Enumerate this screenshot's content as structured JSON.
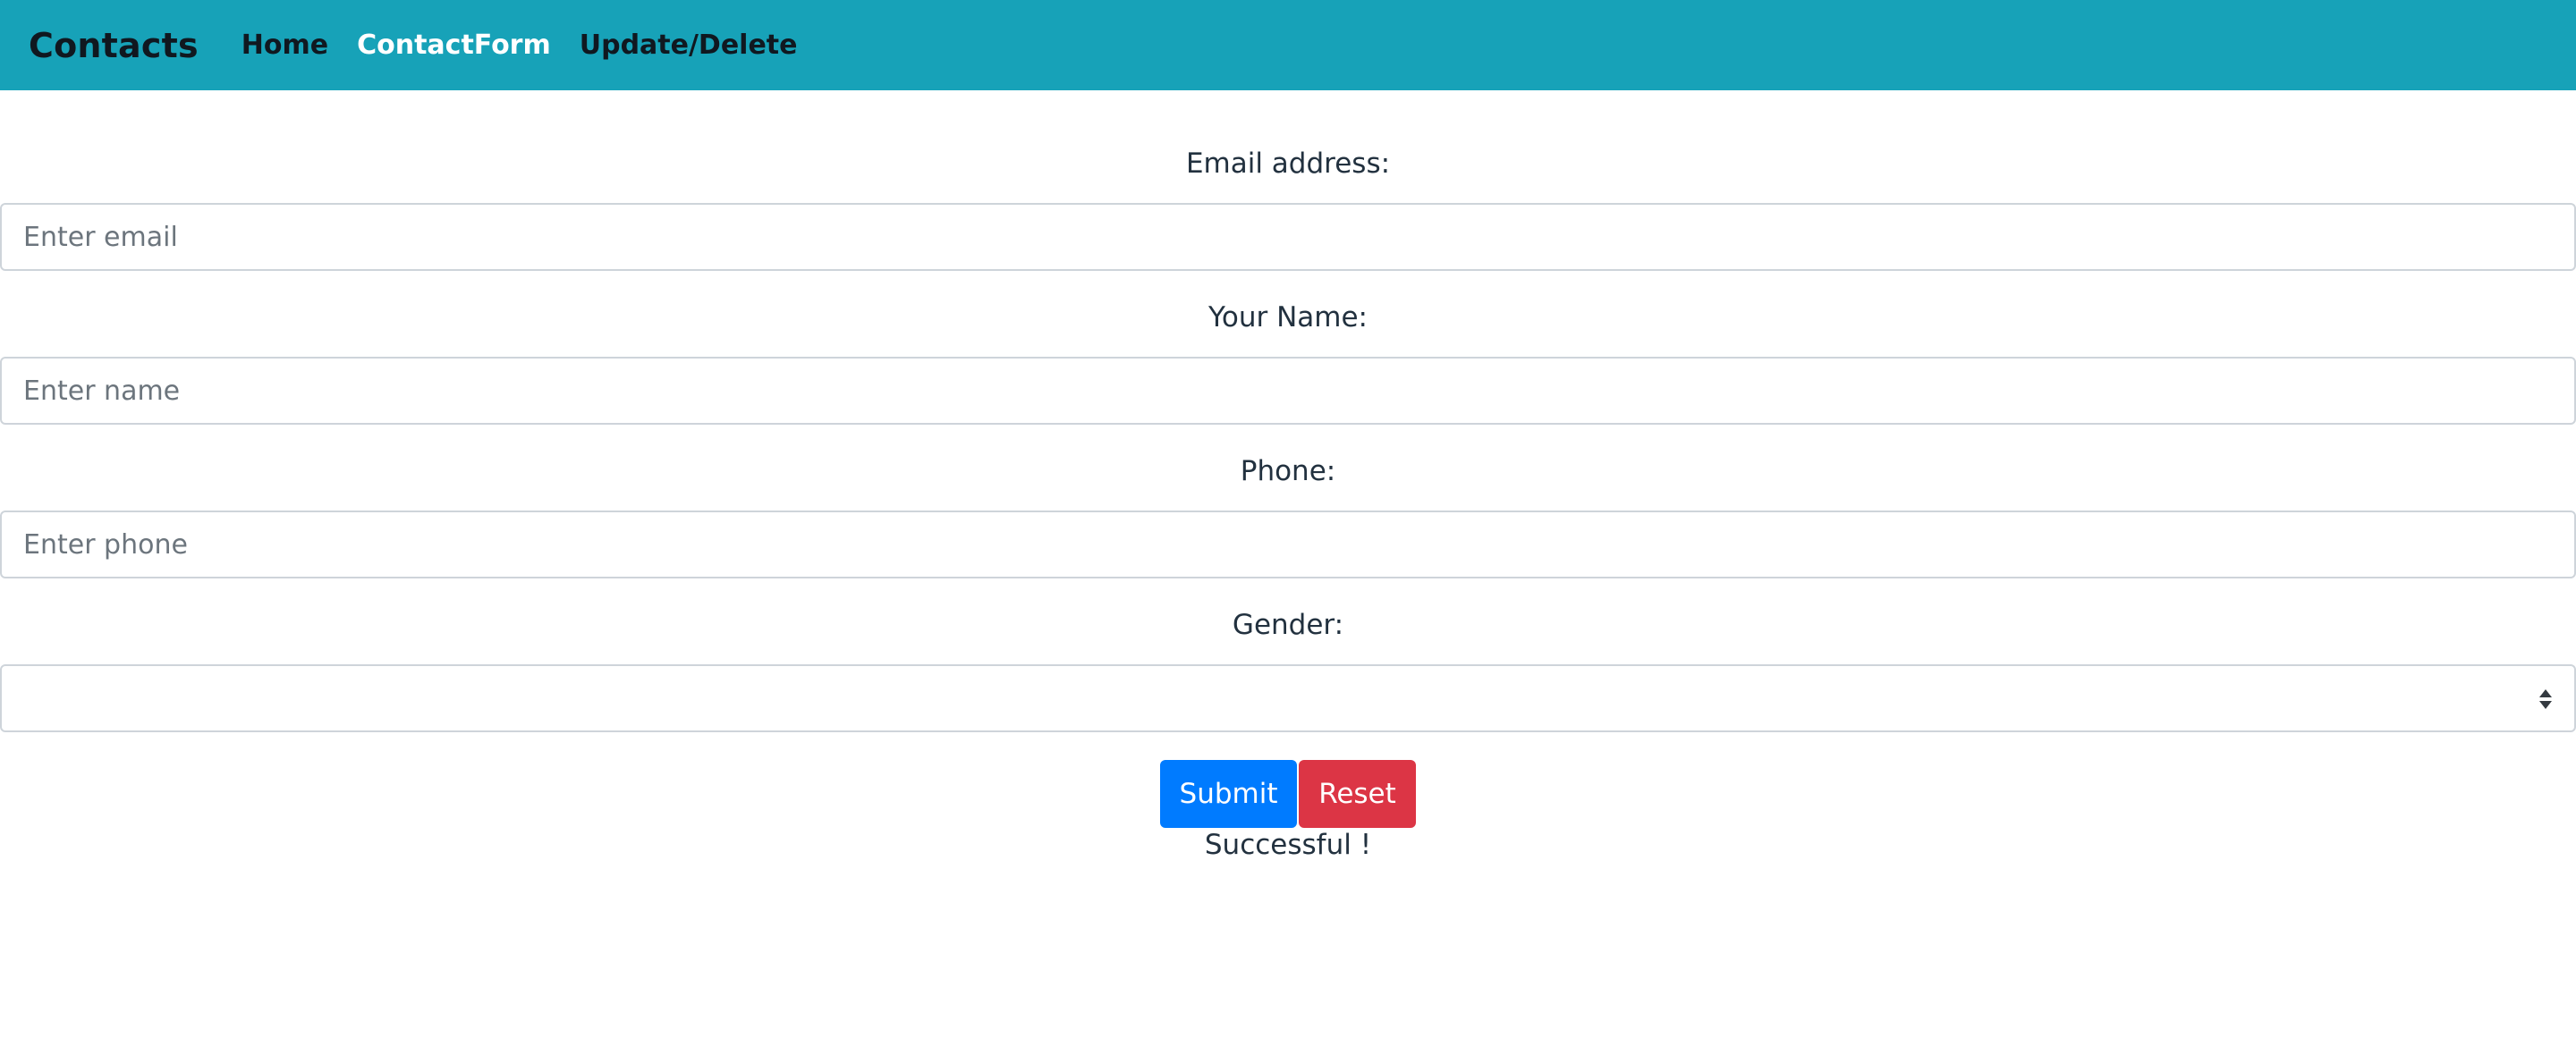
{
  "navbar": {
    "brand": "Contacts",
    "links": [
      {
        "label": "Home",
        "active": false
      },
      {
        "label": "ContactForm",
        "active": true
      },
      {
        "label": "Update/Delete",
        "active": false
      }
    ],
    "background_color": "#17a2b8"
  },
  "form": {
    "email": {
      "label": "Email address:",
      "placeholder": "Enter email",
      "value": ""
    },
    "name": {
      "label": "Your Name:",
      "placeholder": "Enter name",
      "value": ""
    },
    "phone": {
      "label": "Phone:",
      "placeholder": "Enter phone",
      "value": ""
    },
    "gender": {
      "label": "Gender:",
      "selected": ""
    }
  },
  "buttons": {
    "submit_label": "Submit",
    "reset_label": "Reset",
    "submit_color": "#007bff",
    "reset_color": "#dc3545"
  },
  "status_message": "Successful !",
  "icons": {
    "select_arrows": "sort-arrows-icon"
  }
}
